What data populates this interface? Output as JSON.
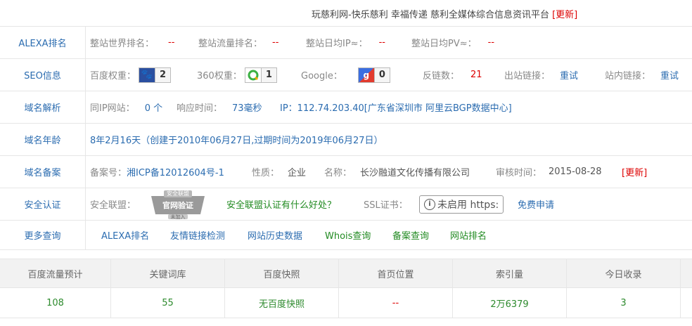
{
  "header": {
    "title": "玩慈利网-快乐慈利 幸福传递 慈利全媒体综合信息资讯平台",
    "update": "[更新]"
  },
  "alexa": {
    "label": "ALEXA排名",
    "world_label": "整站世界排名：",
    "world_value": "--",
    "traffic_label": "整站流量排名：",
    "traffic_value": "--",
    "ip_label": "整站日均IP≈：",
    "ip_value": "--",
    "pv_label": "整站日均PV≈：",
    "pv_value": "--"
  },
  "seo": {
    "label": "SEO信息",
    "baidu_label": "百度权重：",
    "baidu_value": "2",
    "s360_label": "360权重：",
    "s360_value": "1",
    "google_label": "Google：",
    "google_value": "0",
    "backlink_label": "反链数：",
    "backlink_value": "21",
    "outlink_label": "出站链接：",
    "outlink_value": "重试",
    "inlink_label": "站内链接：",
    "inlink_value": "重试"
  },
  "dns": {
    "label": "域名解析",
    "sameip_label": "同IP网站：",
    "sameip_value": "0 个",
    "resp_label": "响应时间：",
    "resp_value": "73毫秒",
    "ip_text": "IP：112.74.203.40[广东省深圳市 阿里云BGP数据中心]"
  },
  "age": {
    "label": "域名年龄",
    "text": "8年2月16天（创建于2010年06月27日,过期时间为2019年06月27日）"
  },
  "icp": {
    "label": "域名备案",
    "no_label": "备案号：",
    "no_value": "湘ICP备12012604号-1",
    "nature_label": "性质：",
    "nature_value": "企业",
    "name_label": "名称：",
    "name_value": "长沙融道文化传播有限公司",
    "date_label": "审核时间：",
    "date_value": "2015-08-28",
    "update": "[更新]"
  },
  "security": {
    "label": "安全认证",
    "alliance_label": "安全联盟：",
    "seal_top": "安全联盟",
    "seal_main": "官网验证",
    "seal_bottom": "未加入",
    "alliance_link": "安全联盟认证有什么好处？",
    "ssl_label": "SSL证书：",
    "ssl_status": "未启用 https:",
    "ssl_apply": "免费申请"
  },
  "more": {
    "label": "更多查询",
    "links": [
      "ALEXA排名",
      "友情链接检测",
      "网站历史数据",
      "Whois查询",
      "备案查询",
      "网站排名"
    ]
  },
  "stats": {
    "headers": [
      "百度流量预计",
      "关键词库",
      "百度快照",
      "首页位置",
      "索引量",
      "今日收录"
    ],
    "values": [
      "108",
      "55",
      "无百度快照",
      "--",
      "2万6379",
      "3"
    ]
  },
  "colors": {
    "label_blue": "#2b6cb0",
    "value_red": "#dd0000",
    "value_green": "#228b22"
  }
}
